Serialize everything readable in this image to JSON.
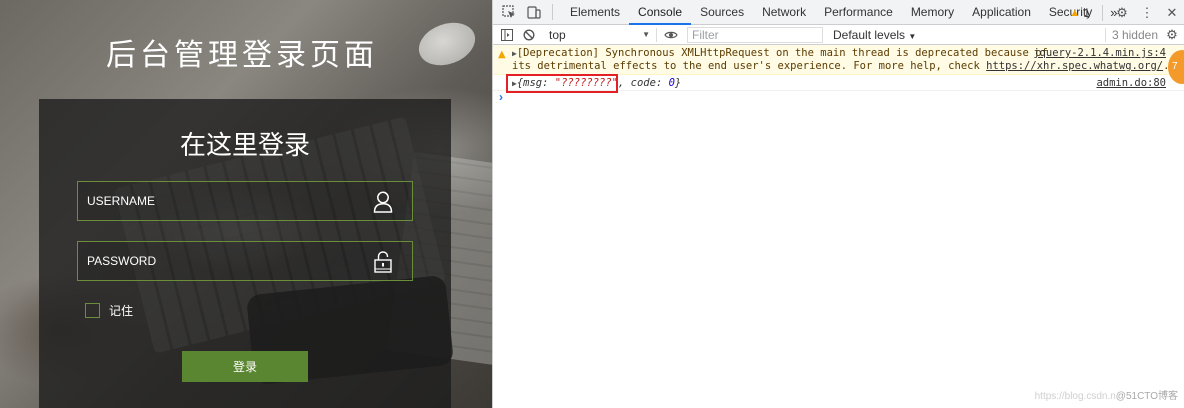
{
  "login_page": {
    "title": "后台管理登录页面",
    "panel_heading": "在这里登录",
    "username_placeholder": "USERNAME",
    "password_placeholder": "PASSWORD",
    "remember_label": "记住",
    "remember_checked": false,
    "submit_label": "登录",
    "colors": {
      "accent": "#5b8631",
      "field_border": "#6b8e3a"
    },
    "icons": {
      "username": "user-icon",
      "password": "lock-icon"
    }
  },
  "devtools": {
    "tabs": [
      "Elements",
      "Console",
      "Sources",
      "Network",
      "Performance",
      "Memory",
      "Application",
      "Security"
    ],
    "active_tab": "Console",
    "more_tabs": "»",
    "warning_count": "1",
    "context": "top",
    "filter_placeholder": "Filter",
    "levels": "Default levels",
    "hidden_count": "3 hidden",
    "messages": {
      "warning": {
        "line1": "[Deprecation] Synchronous XMLHttpRequest on the main thread is deprecated because of",
        "line2_prefix": "its detrimental effects to the end user's experience. For more help, check ",
        "link": "https://xhr.spec.whatwg.org/",
        "line2_suffix": ".",
        "source": "jquery-2.1.4.min.js:4"
      },
      "log": {
        "open": "{",
        "msg_key": "msg:",
        "msg_value": "\"????????\"",
        "comma": ",",
        "code_key": "code:",
        "code_value": "0",
        "close": "}",
        "source": "admin.do:80"
      }
    },
    "prompt": "›"
  },
  "overlay": {
    "badge": "7",
    "watermark_url": "https://blog.csdn.n",
    "watermark_brand": "@51CTO博客"
  }
}
